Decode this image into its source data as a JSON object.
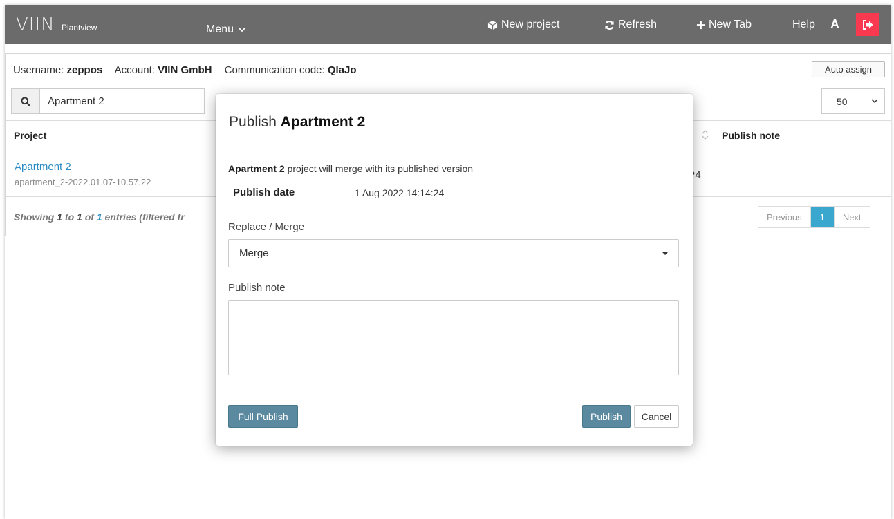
{
  "topbar": {
    "logo": "VIIN",
    "logo_sub": "Plantview",
    "menu": "Menu",
    "new_project": "New project",
    "refresh": "Refresh",
    "new_tab": "New Tab",
    "help": "Help",
    "avatar_letter": "A"
  },
  "user_info": {
    "username_label": "Username:",
    "username": "zeppos",
    "account_label": "Account:",
    "account": "VIIN GmbH",
    "comm_label": "Communication code:",
    "comm_code": "QlaJo"
  },
  "auto_assign": "Auto assign",
  "search": {
    "value": "Apartment 2"
  },
  "page_size": "50",
  "table": {
    "col_project": "Project",
    "col_publish_note": "Publish note",
    "rows": [
      {
        "name": "Apartment 2",
        "sub": "apartment_2-2022.01.07-10.57.22",
        "trail": "24"
      }
    ]
  },
  "footer": {
    "showing": "Showing",
    "from": "1",
    "to_word": "to",
    "to": "1",
    "of_word": "of",
    "total": "1",
    "rest": "entries (filtered fr"
  },
  "pagination": {
    "previous": "Previous",
    "current": "1",
    "next": "Next"
  },
  "modal": {
    "title_prefix": "Publish",
    "title_project": "Apartment 2",
    "desc_project": "Apartment 2",
    "desc_rest": "project will merge with its published version",
    "publish_date_label": "Publish date",
    "publish_date": "1 Aug 2022 14:14:24",
    "replace_merge_label": "Replace / Merge",
    "replace_merge_value": "Merge",
    "publish_note_label": "Publish note",
    "publish_note_value": "",
    "full_publish": "Full Publish",
    "publish": "Publish",
    "cancel": "Cancel"
  },
  "colors": {
    "topbar": "#6b6b6b",
    "logout": "#f8394f",
    "link": "#2a8bc4",
    "primary_button": "#5b8aa0",
    "pager_active": "#3aa7cf"
  }
}
